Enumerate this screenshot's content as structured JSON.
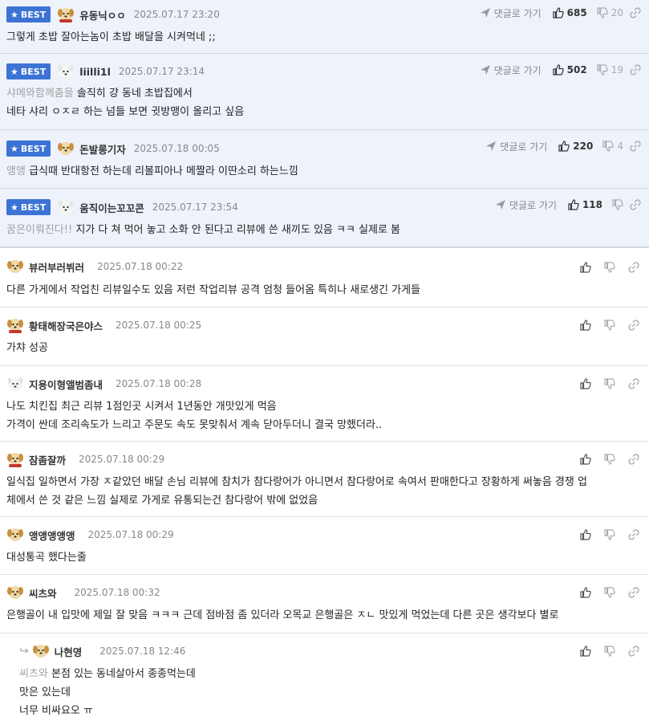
{
  "labels": {
    "best": "BEST",
    "reply_go": "댓글로 가기"
  },
  "best_comments": [
    {
      "nick": "유동닉ㅇㅇ",
      "date": "2025.07.17 23:20",
      "up": "685",
      "down": "20",
      "mention": "",
      "lines": [
        "그렇게 초밥 잘아는놈이 초밥 배달을 시켜먹네 ;;"
      ]
    },
    {
      "nick": "liilli1l",
      "date": "2025.07.17 23:14",
      "up": "502",
      "down": "19",
      "mention": "샤메와함께춤을",
      "lines": [
        "솔직히 걍 동네 초밥집에서",
        "네타 샤리 ㅇㅈㄹ 하는 넘들 보면 귓방맹이 올리고 싶음"
      ]
    },
    {
      "nick": "돈발롱기자",
      "date": "2025.07.18 00:05",
      "up": "220",
      "down": "4",
      "mention": "앵앵",
      "lines": [
        "급식때 반대항전 하는데 리볼피아나 메짤라 이딴소리 하는느낌"
      ]
    },
    {
      "nick": "움직이는꼬꼬콘",
      "date": "2025.07.17 23:54",
      "up": "118",
      "down": "",
      "mention": "꿈은이뤄진다!!",
      "lines": [
        "지가 다 쳐 먹어 놓고 소화 안 된다고 리뷰에 쓴 새끼도 있음 ㅋㅋ 실제로 봄"
      ]
    }
  ],
  "comments": [
    {
      "nick": "뷰러부러뷔러",
      "date": "2025.07.18 00:22",
      "mention": "",
      "lines": [
        "다른 가게에서 작업친 리뷰일수도 있음 저런 작업리뷰 공격 엄청 들어옴 특히나 새로생긴 가게들"
      ]
    },
    {
      "nick": "황태해장국은야스",
      "date": "2025.07.18 00:25",
      "mention": "",
      "lines": [
        "가챠 성공"
      ]
    },
    {
      "nick": "지용이형앨범좀내",
      "date": "2025.07.18 00:28",
      "mention": "",
      "lines": [
        "나도 치킨집 최근 리뷰 1점인곳 시켜서 1년동안 개맛있게 먹음",
        "가격이 싼데 조리속도가 느리고 주문도 속도 못맞춰서 계속 닫아두더니 결국 망했더라.."
      ]
    },
    {
      "nick": "잠좀잘까",
      "date": "2025.07.18 00:29",
      "mention": "",
      "lines": [
        "일식집 일하면서 가장 ㅈ같았던 배달 손님 리뷰에 참치가 참다랑어가 아니면서 참다랑어로 속여서 판매한다고 장황하게 써놓음 경쟁 업",
        "체에서 쓴 것 같은 느낌 실제로 가게로 유통되는건 참다랑어 밖에 없었음"
      ]
    },
    {
      "nick": "앵앵앵앵앵",
      "date": "2025.07.18 00:29",
      "mention": "",
      "lines": [
        "대성통곡 했다는줄"
      ]
    },
    {
      "nick": "씨츠와",
      "date": "2025.07.18 00:32",
      "mention": "",
      "lines": [
        "은행골이 내 입맛에 제일 잘 맞음 ㅋㅋㅋ 근데 점바점 좀 있더라 오목교 은행골은 ㅈㄴ 맛있게 먹었는데 다른 곳은 생각보다 별로"
      ]
    },
    {
      "nick": "나현영",
      "date": "2025.07.18 12:46",
      "mention": "씨츠와",
      "lines": [
        "본점 있는 동네살아서 종종먹는데",
        "맛은 있는데",
        "너무 비싸요오 ㅠ"
      ]
    }
  ]
}
